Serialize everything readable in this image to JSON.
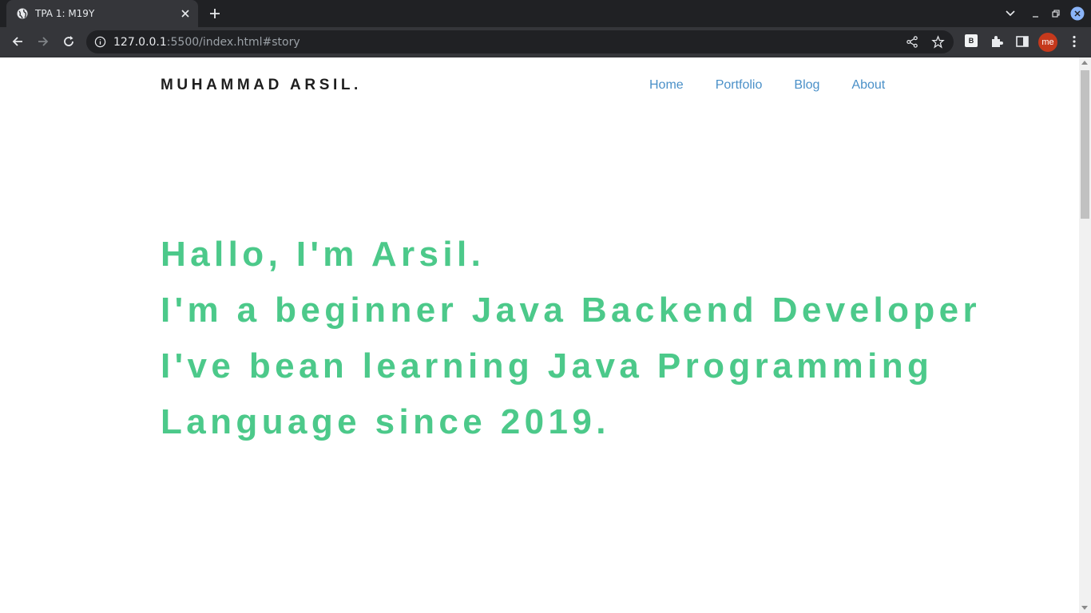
{
  "browser": {
    "tab_title": "TPA 1: M19Y",
    "url_host": "127.0.0.1",
    "url_rest": ":5500/index.html#story",
    "extension_label": "B",
    "profile_label": "me"
  },
  "page": {
    "brand": "MUHAMMAD ARSIL.",
    "nav": [
      {
        "label": "Home"
      },
      {
        "label": "Portfolio"
      },
      {
        "label": "Blog"
      },
      {
        "label": "About"
      }
    ],
    "hero_lines": [
      "Hallo, I'm Arsil.",
      "I'm a beginner Java Backend Developer",
      "I've bean learning Java Programming",
      "Language since 2019."
    ]
  },
  "colors": {
    "accent_green": "#4cc98a",
    "nav_blue": "#4a90c8",
    "brand_text": "#1e1e1e"
  }
}
